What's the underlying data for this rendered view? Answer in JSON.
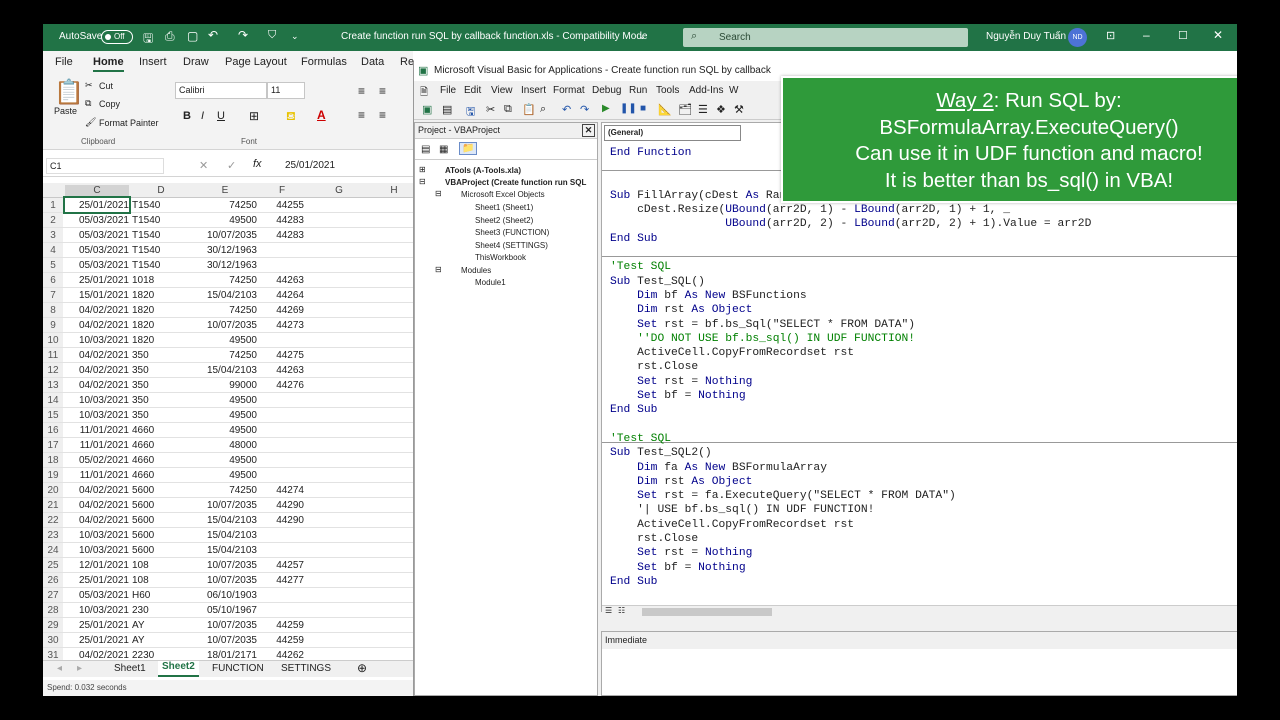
{
  "excel": {
    "autosave_label": "AutoSave",
    "autosave_state": "Off",
    "title": "Create function run SQL by callback function.xls  -  Compatibility Mode",
    "search_placeholder": "Search",
    "user_name": "Nguyễn Duy Tuấn",
    "user_initials": "ND",
    "tabs": [
      "File",
      "Home",
      "Insert",
      "Draw",
      "Page Layout",
      "Formulas",
      "Data",
      "Re"
    ],
    "ribbon": {
      "paste": "Paste",
      "cut": "Cut",
      "copy": "Copy",
      "format_painter": "Format Painter",
      "clipboard": "Clipboard",
      "font_name": "Calibri",
      "font_size": "11",
      "font_group": "Font"
    },
    "name_box": "C1",
    "formula_value": "25/01/2021",
    "columns": [
      "C",
      "D",
      "E",
      "F",
      "G",
      "H"
    ],
    "rows": [
      [
        "1",
        "25/01/2021",
        "T1540",
        "74250",
        "44255"
      ],
      [
        "2",
        "05/03/2021",
        "T1540",
        "49500",
        "44283"
      ],
      [
        "3",
        "05/03/2021",
        "T1540",
        "10/07/2035",
        "44283"
      ],
      [
        "4",
        "05/03/2021",
        "T1540",
        "30/12/1963",
        ""
      ],
      [
        "5",
        "05/03/2021",
        "T1540",
        "30/12/1963",
        ""
      ],
      [
        "6",
        "25/01/2021",
        "1018",
        "74250",
        "44263"
      ],
      [
        "7",
        "15/01/2021",
        "1820",
        "15/04/2103",
        "44264"
      ],
      [
        "8",
        "04/02/2021",
        "1820",
        "74250",
        "44269"
      ],
      [
        "9",
        "04/02/2021",
        "1820",
        "10/07/2035",
        "44273"
      ],
      [
        "10",
        "10/03/2021",
        "1820",
        "49500",
        ""
      ],
      [
        "11",
        "04/02/2021",
        "350",
        "74250",
        "44275"
      ],
      [
        "12",
        "04/02/2021",
        "350",
        "15/04/2103",
        "44263"
      ],
      [
        "13",
        "04/02/2021",
        "350",
        "99000",
        "44276"
      ],
      [
        "14",
        "10/03/2021",
        "350",
        "49500",
        ""
      ],
      [
        "15",
        "10/03/2021",
        "350",
        "49500",
        ""
      ],
      [
        "16",
        "11/01/2021",
        "4660",
        "49500",
        ""
      ],
      [
        "17",
        "11/01/2021",
        "4660",
        "48000",
        ""
      ],
      [
        "18",
        "05/02/2021",
        "4660",
        "49500",
        ""
      ],
      [
        "19",
        "11/01/2021",
        "4660",
        "49500",
        ""
      ],
      [
        "20",
        "04/02/2021",
        "5600",
        "74250",
        "44274"
      ],
      [
        "21",
        "04/02/2021",
        "5600",
        "10/07/2035",
        "44290"
      ],
      [
        "22",
        "04/02/2021",
        "5600",
        "15/04/2103",
        "44290"
      ],
      [
        "23",
        "10/03/2021",
        "5600",
        "15/04/2103",
        ""
      ],
      [
        "24",
        "10/03/2021",
        "5600",
        "15/04/2103",
        ""
      ],
      [
        "25",
        "12/01/2021",
        "108",
        "10/07/2035",
        "44257"
      ],
      [
        "26",
        "25/01/2021",
        "108",
        "10/07/2035",
        "44277"
      ],
      [
        "27",
        "05/03/2021",
        "H60",
        "06/10/1903",
        ""
      ],
      [
        "28",
        "10/03/2021",
        "230",
        "05/10/1967",
        ""
      ],
      [
        "29",
        "25/01/2021",
        "AY",
        "10/07/2035",
        "44259"
      ],
      [
        "30",
        "25/01/2021",
        "AY",
        "10/07/2035",
        "44259"
      ],
      [
        "31",
        "04/02/2021",
        "2230",
        "18/01/2171",
        "44262"
      ]
    ],
    "sheet_tabs": [
      "Sheet1",
      "Sheet2",
      "FUNCTION",
      "SETTINGS"
    ],
    "status": "Spend: 0.032 seconds"
  },
  "vbe": {
    "title": "Microsoft Visual Basic for Applications - Create function run SQL by callback",
    "menu": [
      "File",
      "Edit",
      "View",
      "Insert",
      "Format",
      "Debug",
      "Run",
      "Tools",
      "Add-Ins",
      "W"
    ],
    "project_title": "Project - VBAProject",
    "tree": [
      "ATools (A-Tools.xla)",
      "VBAProject (Create function run SQL",
      "Microsoft Excel Objects",
      "Sheet1 (Sheet1)",
      "Sheet2 (Sheet2)",
      "Sheet3 (FUNCTION)",
      "Sheet4 (SETTINGS)",
      "ThisWorkbook",
      "Modules",
      "Module1"
    ],
    "proc_dropdown": "(General)",
    "immediate_title": "Immediate"
  },
  "callout": {
    "line1_prefix": "Way 2",
    "line1_rest": ": Run SQL by:",
    "line2": "BSFormulaArray.ExecuteQuery()",
    "line3": "Can use it in UDF function and macro!",
    "line4": "It is better than bs_sql() in VBA!"
  }
}
